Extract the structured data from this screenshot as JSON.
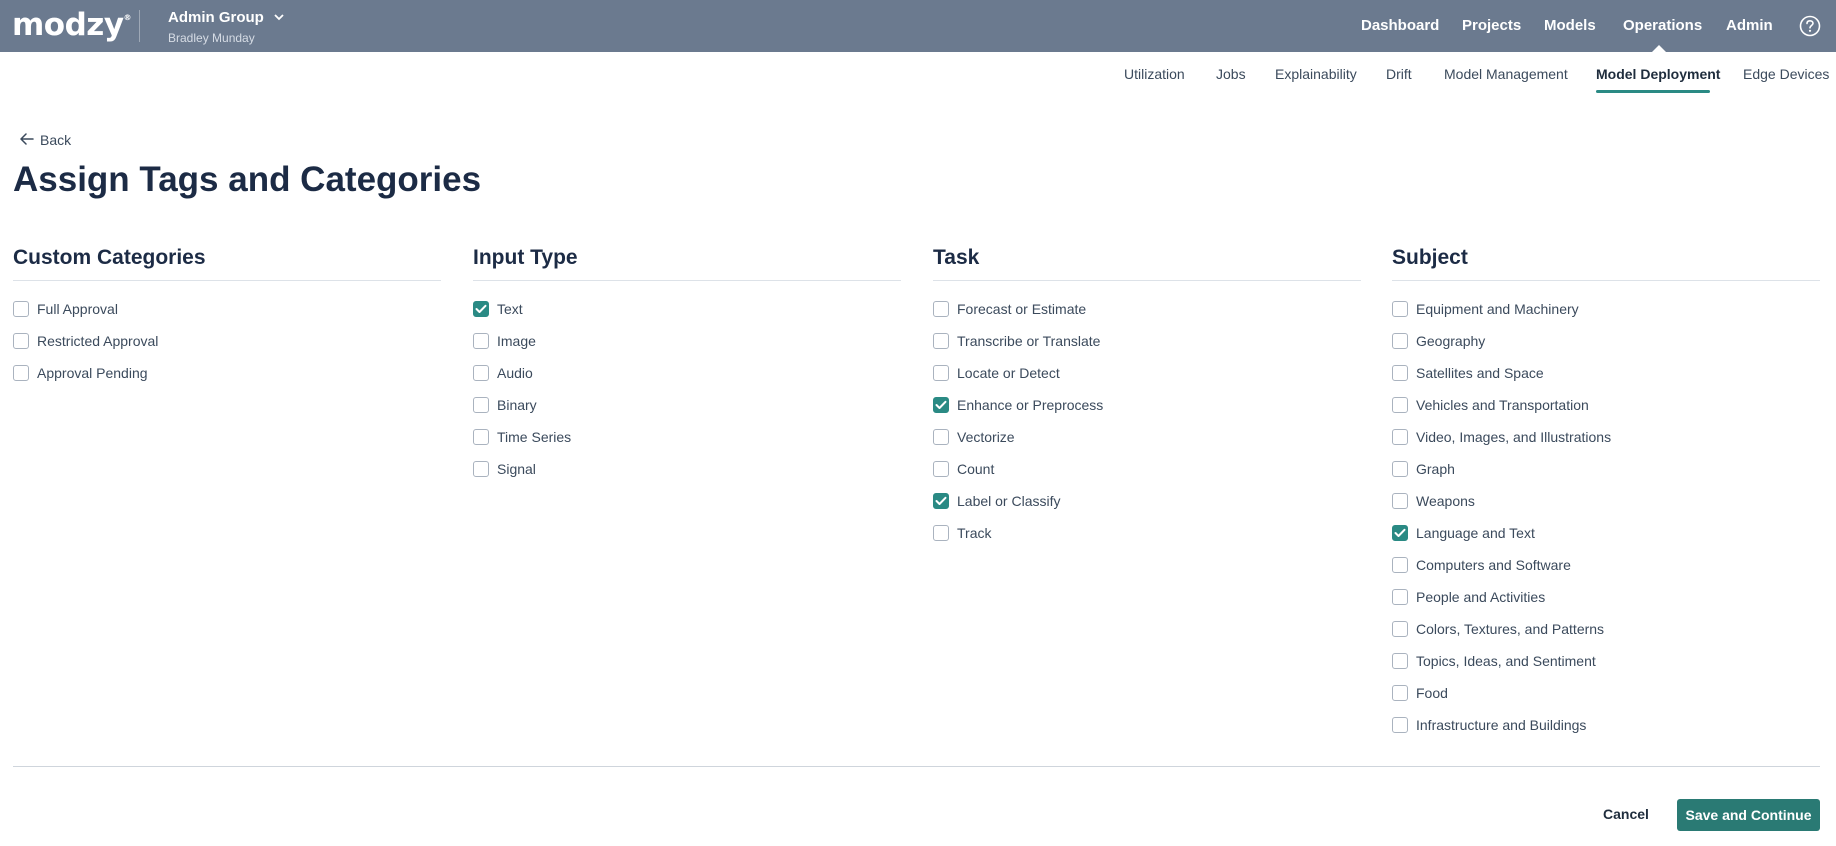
{
  "header": {
    "logo": "modzy",
    "group_name": "Admin Group",
    "group_user": "Bradley Munday",
    "nav": [
      "Dashboard",
      "Projects",
      "Models",
      "Operations",
      "Admin"
    ]
  },
  "subnav": [
    "Utilization",
    "Jobs",
    "Explainability",
    "Drift",
    "Model Management",
    "Model Deployment",
    "Edge Devices"
  ],
  "back_label": "Back",
  "title": "Assign Tags and Categories",
  "columns": [
    {
      "heading": "Custom Categories",
      "options": [
        {
          "label": "Full Approval",
          "checked": false
        },
        {
          "label": "Restricted Approval",
          "checked": false
        },
        {
          "label": "Approval Pending",
          "checked": false
        }
      ]
    },
    {
      "heading": "Input Type",
      "options": [
        {
          "label": "Text",
          "checked": true
        },
        {
          "label": "Image",
          "checked": false
        },
        {
          "label": "Audio",
          "checked": false
        },
        {
          "label": "Binary",
          "checked": false
        },
        {
          "label": "Time Series",
          "checked": false
        },
        {
          "label": "Signal",
          "checked": false
        }
      ]
    },
    {
      "heading": "Task",
      "options": [
        {
          "label": "Forecast or Estimate",
          "checked": false
        },
        {
          "label": "Transcribe or Translate",
          "checked": false
        },
        {
          "label": "Locate or Detect",
          "checked": false
        },
        {
          "label": "Enhance or Preprocess",
          "checked": true
        },
        {
          "label": "Vectorize",
          "checked": false
        },
        {
          "label": "Count",
          "checked": false
        },
        {
          "label": "Label or Classify",
          "checked": true
        },
        {
          "label": "Track",
          "checked": false
        }
      ]
    },
    {
      "heading": "Subject",
      "options": [
        {
          "label": "Equipment and Machinery",
          "checked": false
        },
        {
          "label": "Geography",
          "checked": false
        },
        {
          "label": "Satellites and Space",
          "checked": false
        },
        {
          "label": "Vehicles and Transportation",
          "checked": false
        },
        {
          "label": "Video, Images, and Illustrations",
          "checked": false
        },
        {
          "label": "Graph",
          "checked": false
        },
        {
          "label": "Weapons",
          "checked": false
        },
        {
          "label": "Language and Text",
          "checked": true
        },
        {
          "label": "Computers and Software",
          "checked": false
        },
        {
          "label": "People and Activities",
          "checked": false
        },
        {
          "label": "Colors, Textures, and Patterns",
          "checked": false
        },
        {
          "label": "Topics, Ideas, and Sentiment",
          "checked": false
        },
        {
          "label": "Food",
          "checked": false
        },
        {
          "label": "Infrastructure and Buildings",
          "checked": false
        }
      ]
    }
  ],
  "footer": {
    "cancel_label": "Cancel",
    "save_label": "Save and Continue"
  },
  "colors": {
    "topbar": "#6b7a8f",
    "accent": "#2a8a84",
    "primary_button": "#2a7a74"
  }
}
